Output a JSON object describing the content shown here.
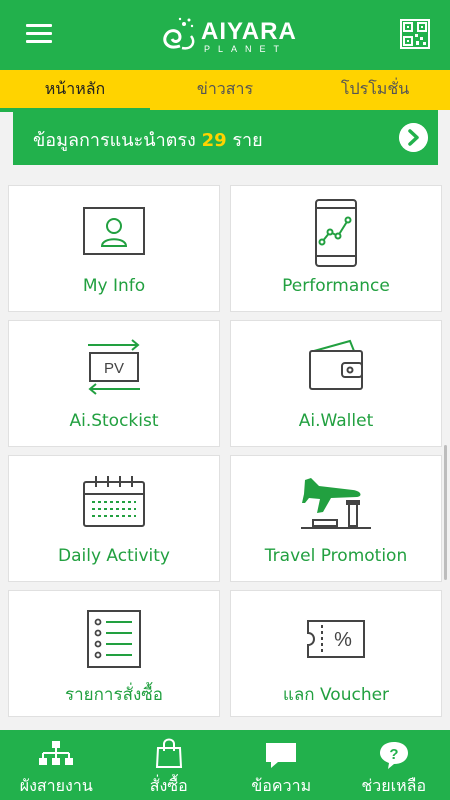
{
  "header": {
    "logo_title": "AIYARA",
    "logo_subtitle": "PLANET",
    "menu_icon": "hamburger-icon",
    "qr_icon": "qr-code-icon"
  },
  "tabs": [
    {
      "label": "หน้าหลัก",
      "active": true
    },
    {
      "label": "ข่าวสาร",
      "active": false
    },
    {
      "label": "โปรโมชั่น",
      "active": false
    }
  ],
  "banner": {
    "text": "ข้อมูลการแนะนำตรง",
    "count": "29",
    "unit": "ราย",
    "arrow_icon": "chevron-right-icon"
  },
  "cards": [
    {
      "label": "My Info",
      "icon": "profile-card-icon"
    },
    {
      "label": "Performance",
      "icon": "phone-chart-icon"
    },
    {
      "label": "Ai.Stockist",
      "icon": "pv-transfer-icon"
    },
    {
      "label": "Ai.Wallet",
      "icon": "wallet-icon"
    },
    {
      "label": "Daily Activity",
      "icon": "calendar-icon"
    },
    {
      "label": "Travel Promotion",
      "icon": "airplane-icon"
    },
    {
      "label": "รายการสั่งซื้อ",
      "icon": "order-list-icon"
    },
    {
      "label": "แลก Voucher",
      "icon": "voucher-icon"
    }
  ],
  "bottom_nav": [
    {
      "label": "ผังสายงาน",
      "icon": "org-chart-icon"
    },
    {
      "label": "สั่งซื้อ",
      "icon": "shopping-bag-icon"
    },
    {
      "label": "ข้อความ",
      "icon": "message-icon"
    },
    {
      "label": "ช่วยเหลือ",
      "icon": "help-icon"
    }
  ],
  "colors": {
    "primary_green": "#22b14c",
    "tab_yellow": "#ffd300",
    "label_green": "#22a040",
    "icon_gray": "#444444"
  }
}
